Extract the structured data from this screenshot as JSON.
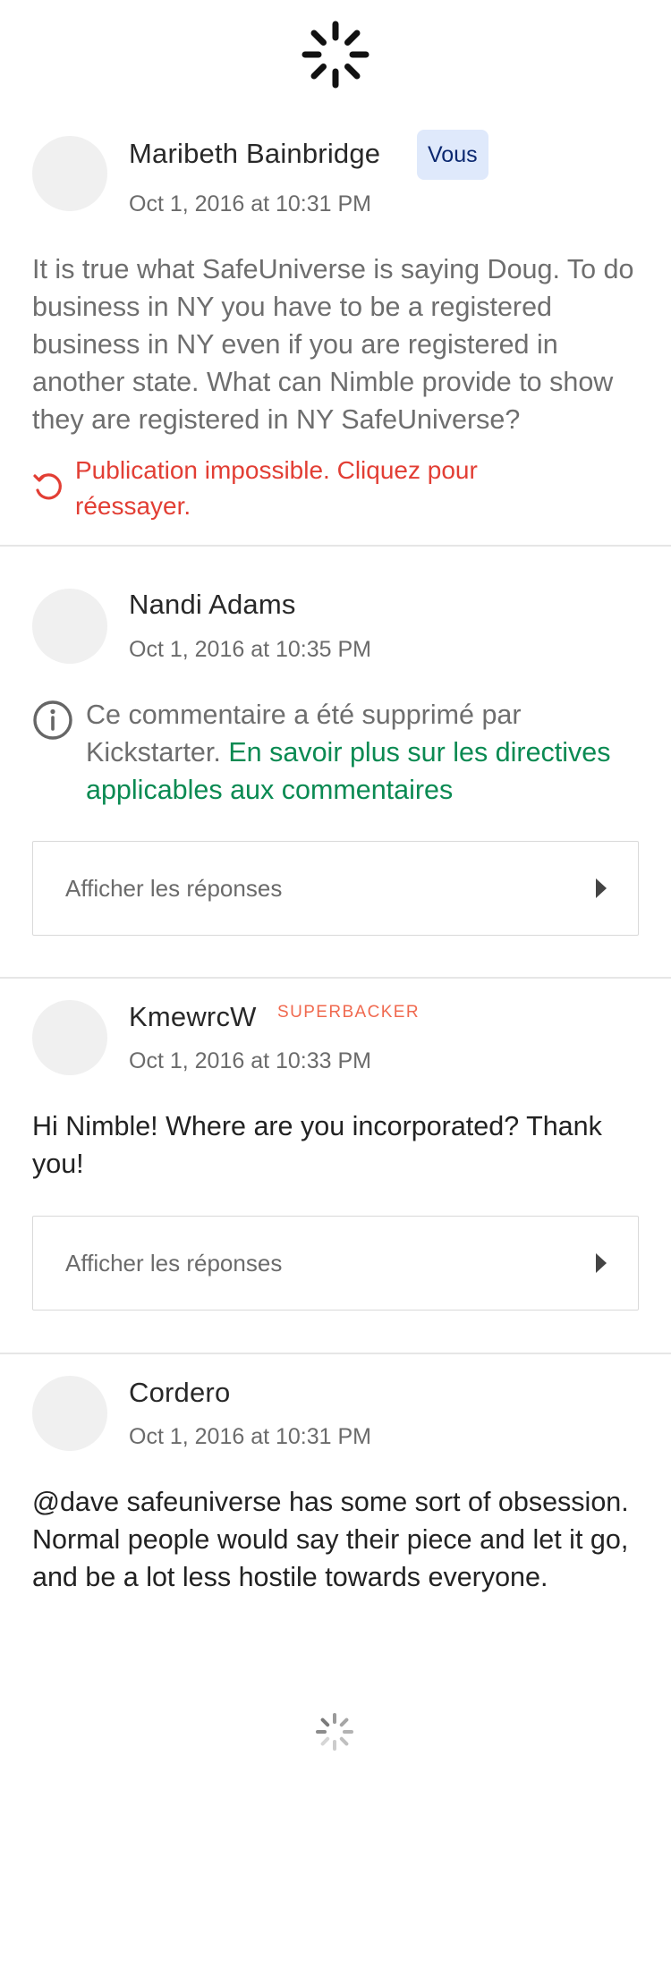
{
  "comments": [
    {
      "author": "Maribeth Bainbridge",
      "badge": "Vous",
      "timestamp": "Oct 1, 2016 at 10:31 PM",
      "body": "It is true what SafeUniverse is saying Doug. To do business in NY you have to be a registered business in NY even if you are registered in another state. What can Nimble provide to show they are registered in NY SafeUniverse?",
      "error": "Publication impossible. Cliquez pour réessayer."
    },
    {
      "author": "Nandi Adams",
      "timestamp": "Oct 1, 2016 at 10:35 PM",
      "deleted_text": "Ce commentaire a été supprimé par Kickstarter.",
      "deleted_link": "En savoir plus sur les directives applicables aux commentaires",
      "replies_label": "Afficher les réponses"
    },
    {
      "author": "KmewrcW",
      "badge": "SUPERBACKER",
      "timestamp": "Oct 1, 2016 at 10:33 PM",
      "body": "Hi Nimble! Where are you incorporated? Thank you!",
      "replies_label": "Afficher les réponses"
    },
    {
      "author": "Cordero",
      "timestamp": "Oct 1, 2016 at 10:31 PM",
      "body": "@dave safeuniverse has some sort of obsession. Normal people would say their piece and let it go, and be a lot less hostile towards everyone."
    }
  ],
  "icons": {
    "top_loader": "loading-spinner-icon",
    "retry": "retry-icon",
    "info": "info-icon",
    "caret": "caret-right-icon",
    "bottom_loader": "loading-spinner-icon"
  },
  "colors": {
    "error": "#e23e34",
    "link": "#0a8a52",
    "superbacker": "#f0694f",
    "you_badge_bg": "#dfe9fb",
    "you_badge_text": "#0b2870"
  }
}
